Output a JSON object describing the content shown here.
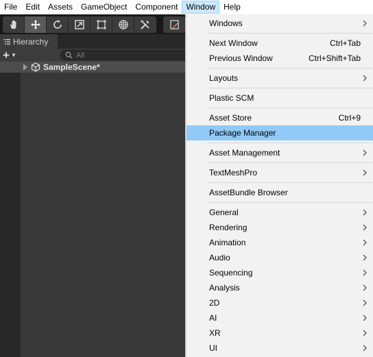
{
  "menubar": {
    "items": [
      "File",
      "Edit",
      "Assets",
      "GameObject",
      "Component",
      "Window",
      "Help"
    ],
    "active_index": 5
  },
  "toolbar": {
    "tools": [
      "hand-tool-icon",
      "move-tool-icon",
      "rotate-tool-icon",
      "scale-tool-icon",
      "rect-tool-icon",
      "transform-tool-icon",
      "custom-tool-icon"
    ],
    "active_tool": "move-tool-icon"
  },
  "hierarchy": {
    "tab_label": "Hierarchy",
    "search_placeholder": "All",
    "scene_name": "SampleScene*"
  },
  "window_menu": {
    "items": [
      {
        "label": "Windows",
        "shortcut": "",
        "submenu": true
      },
      {
        "label": "Next Window",
        "shortcut": "Ctrl+Tab",
        "submenu": false
      },
      {
        "label": "Previous Window",
        "shortcut": "Ctrl+Shift+Tab",
        "submenu": false
      },
      {
        "label": "Layouts",
        "shortcut": "",
        "submenu": true
      },
      {
        "label": "Plastic SCM",
        "shortcut": "",
        "submenu": false
      },
      {
        "label": "Asset Store",
        "shortcut": "Ctrl+9",
        "submenu": false
      },
      {
        "label": "Package Manager",
        "shortcut": "",
        "submenu": false,
        "highlighted": true
      },
      {
        "label": "Asset Management",
        "shortcut": "",
        "submenu": true
      },
      {
        "label": "TextMeshPro",
        "shortcut": "",
        "submenu": true
      },
      {
        "label": "AssetBundle Browser",
        "shortcut": "",
        "submenu": false
      },
      {
        "label": "General",
        "shortcut": "",
        "submenu": true
      },
      {
        "label": "Rendering",
        "shortcut": "",
        "submenu": true
      },
      {
        "label": "Animation",
        "shortcut": "",
        "submenu": true
      },
      {
        "label": "Audio",
        "shortcut": "",
        "submenu": true
      },
      {
        "label": "Sequencing",
        "shortcut": "",
        "submenu": true
      },
      {
        "label": "Analysis",
        "shortcut": "",
        "submenu": true
      },
      {
        "label": "2D",
        "shortcut": "",
        "submenu": true
      },
      {
        "label": "AI",
        "shortcut": "",
        "submenu": true
      },
      {
        "label": "XR",
        "shortcut": "",
        "submenu": true
      },
      {
        "label": "UI",
        "shortcut": "",
        "submenu": true
      }
    ]
  },
  "colors": {
    "highlight": "#91c9f7",
    "menu_bg": "#f2f2f2",
    "editor_bg": "#383838"
  }
}
